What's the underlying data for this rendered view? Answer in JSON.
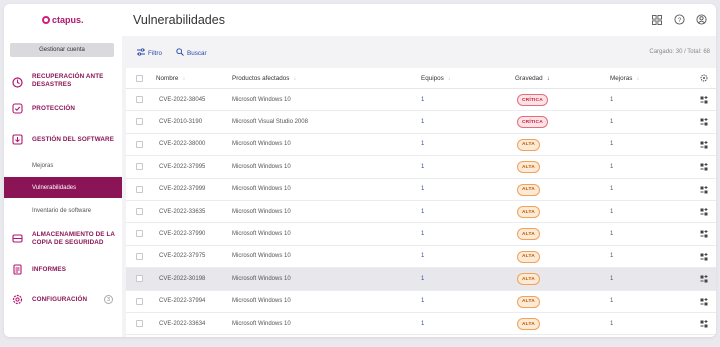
{
  "brand": {
    "logo_text": "ctapus."
  },
  "sidebar": {
    "manage_account": "Gestionar cuenta",
    "items": [
      {
        "label": "RECUPERACIÓN ANTE DESASTRES",
        "icon": "recovery-icon"
      },
      {
        "label": "PROTECCIÓN",
        "icon": "shield-icon"
      },
      {
        "label": "GESTIÓN DEL SOFTWARE",
        "icon": "download-icon"
      },
      {
        "label": "ALMACENAMIENTO DE LA COPIA DE SEGURIDAD",
        "icon": "storage-icon"
      },
      {
        "label": "INFORMES",
        "icon": "report-icon"
      },
      {
        "label": "CONFIGURACIÓN",
        "icon": "gear-icon",
        "badge": "3"
      }
    ],
    "subitems": [
      {
        "label": "Mejoras"
      },
      {
        "label": "Vulnerabilidades",
        "active": true
      },
      {
        "label": "Inventario de software"
      }
    ]
  },
  "header": {
    "title": "Vulnerabilidades"
  },
  "toolbar": {
    "filter_label": "Filtro",
    "search_label": "Buscar",
    "loaded_text": "Cargado: 30 / Total: 68"
  },
  "table": {
    "columns": [
      "Nombre",
      "Productos afectados",
      "Equipos",
      "Gravedad",
      "Mejoras"
    ],
    "rows": [
      {
        "name": "CVE-2022-38045",
        "product": "Microsoft Windows 10",
        "devices": "1",
        "severity": "CRÍTICA",
        "level": "critica",
        "fixes": "1"
      },
      {
        "name": "CVE-2010-3190",
        "product": "Microsoft Visual Studio 2008",
        "devices": "1",
        "severity": "CRÍTICA",
        "level": "critica",
        "fixes": "1"
      },
      {
        "name": "CVE-2022-38000",
        "product": "Microsoft Windows 10",
        "devices": "1",
        "severity": "ALTA",
        "level": "alta",
        "fixes": "1"
      },
      {
        "name": "CVE-2022-37995",
        "product": "Microsoft Windows 10",
        "devices": "1",
        "severity": "ALTA",
        "level": "alta",
        "fixes": "1"
      },
      {
        "name": "CVE-2022-37999",
        "product": "Microsoft Windows 10",
        "devices": "1",
        "severity": "ALTA",
        "level": "alta",
        "fixes": "1"
      },
      {
        "name": "CVE-2022-33635",
        "product": "Microsoft Windows 10",
        "devices": "1",
        "severity": "ALTA",
        "level": "alta",
        "fixes": "1"
      },
      {
        "name": "CVE-2022-37990",
        "product": "Microsoft Windows 10",
        "devices": "1",
        "severity": "ALTA",
        "level": "alta",
        "fixes": "1"
      },
      {
        "name": "CVE-2022-37975",
        "product": "Microsoft Windows 10",
        "devices": "1",
        "severity": "ALTA",
        "level": "alta",
        "fixes": "1"
      },
      {
        "name": "CVE-2022-30198",
        "product": "Microsoft Windows 10",
        "devices": "1",
        "severity": "ALTA",
        "level": "alta",
        "fixes": "1",
        "highlighted": true
      },
      {
        "name": "CVE-2022-37994",
        "product": "Microsoft Windows 10",
        "devices": "1",
        "severity": "ALTA",
        "level": "alta",
        "fixes": "1"
      },
      {
        "name": "CVE-2022-33634",
        "product": "Microsoft Windows 10",
        "devices": "1",
        "severity": "ALTA",
        "level": "alta",
        "fixes": "1"
      }
    ]
  },
  "colors": {
    "brand": "#8b1457",
    "link": "#2a4aa8",
    "critical": "#c21d3a",
    "high": "#b35a00"
  }
}
